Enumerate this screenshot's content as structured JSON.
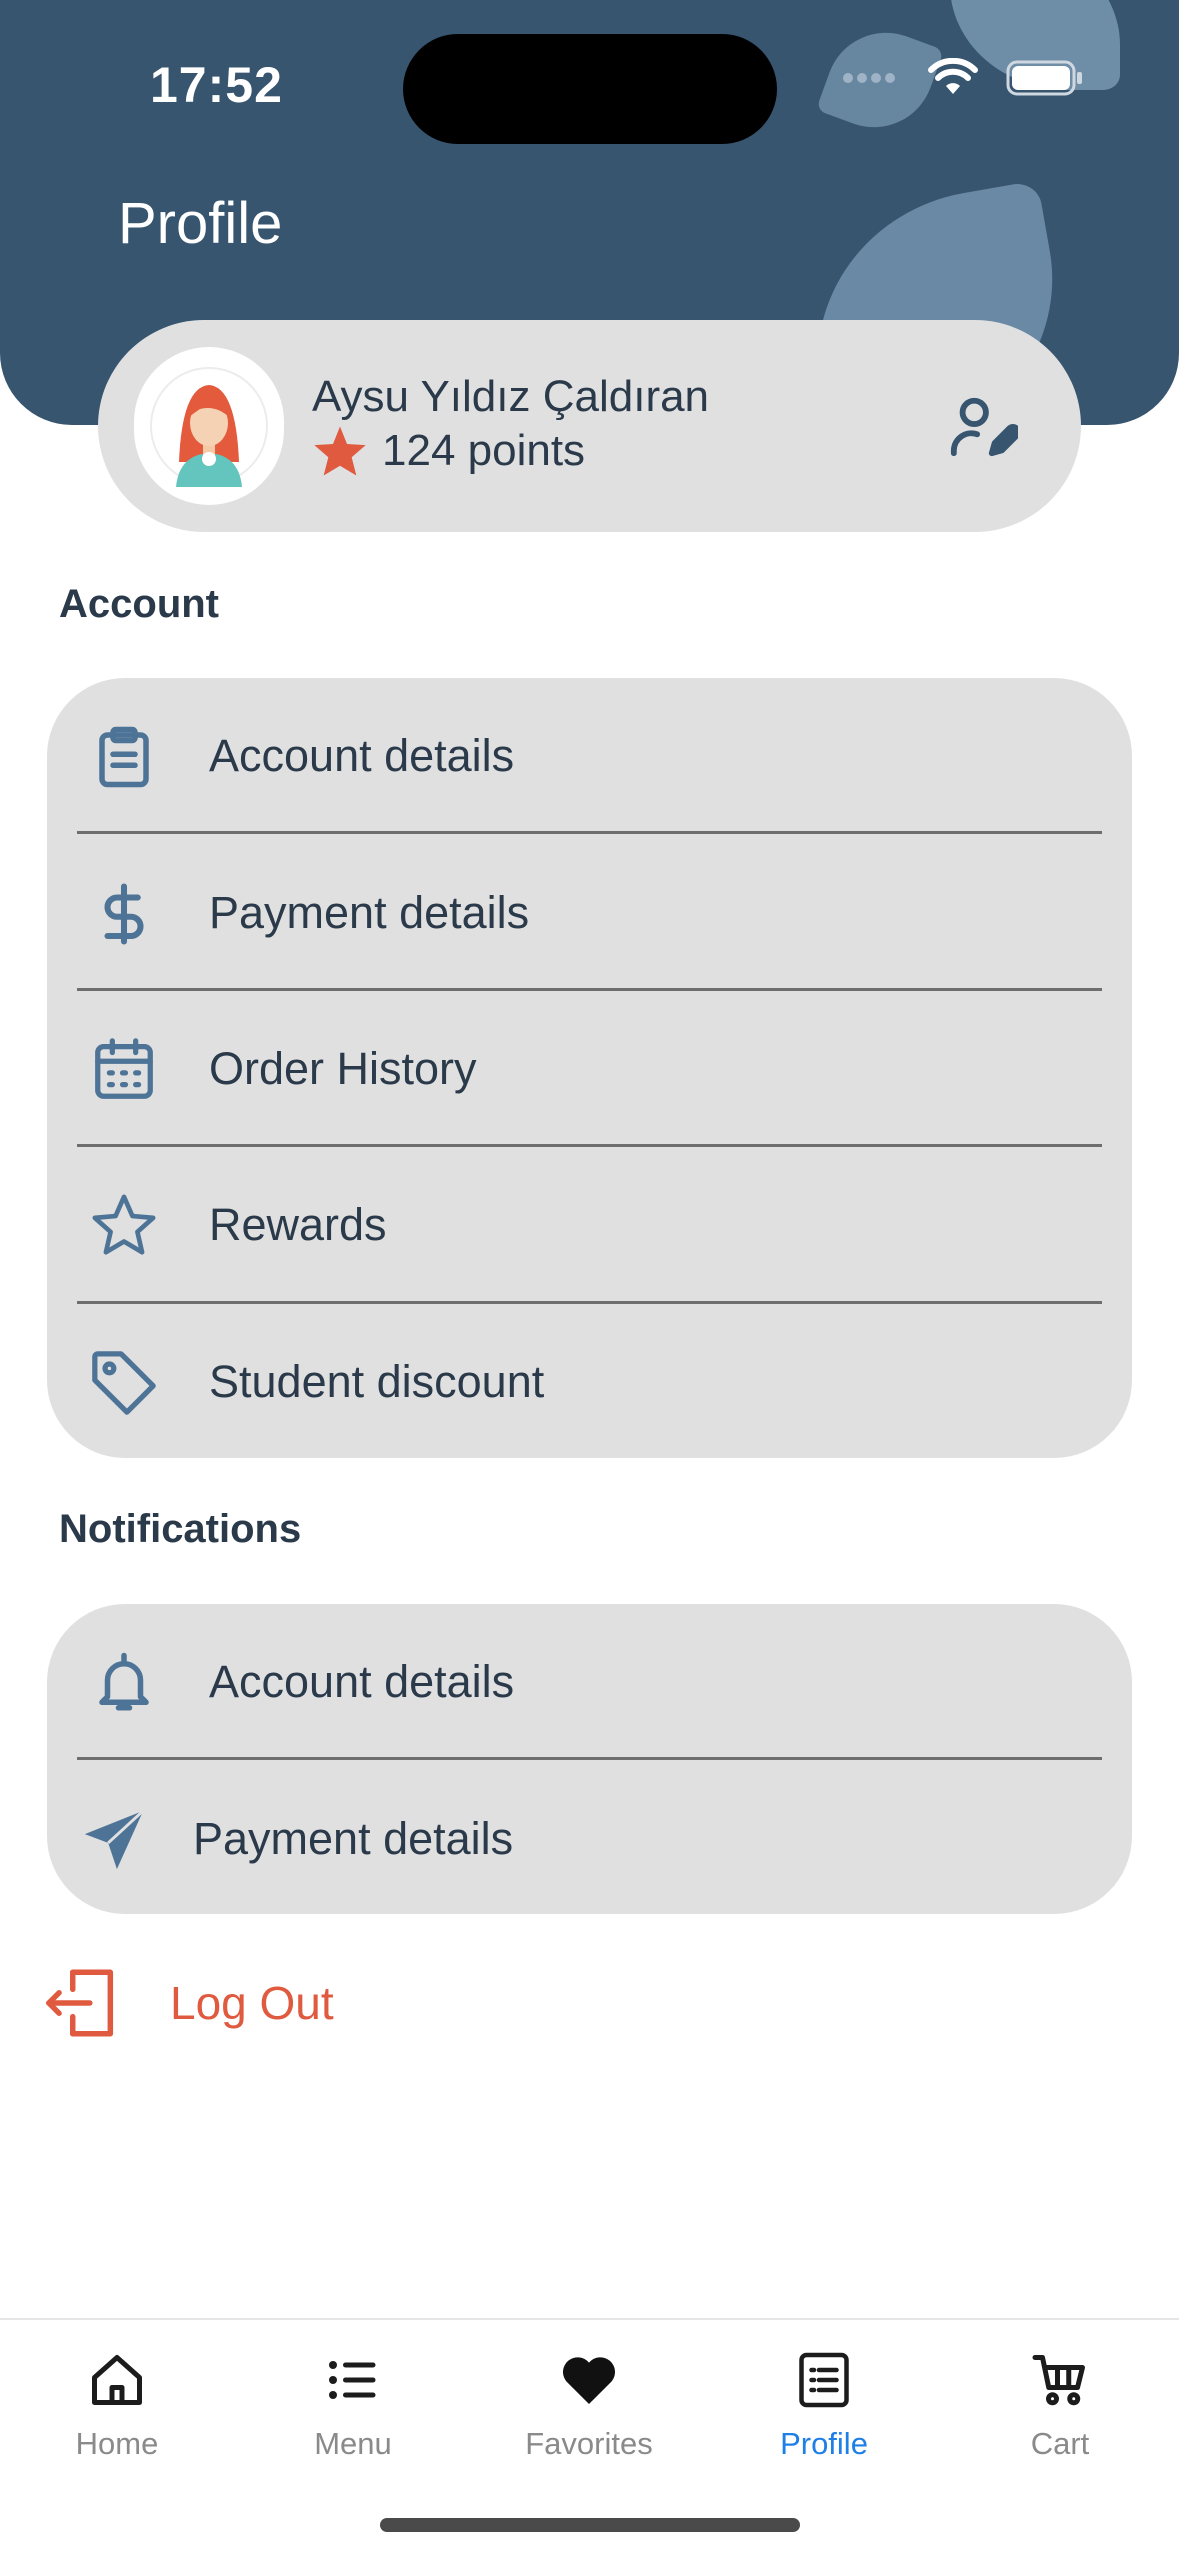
{
  "status_bar": {
    "time": "17:52"
  },
  "page": {
    "title": "Profile"
  },
  "profile": {
    "name": "Aysu Yıldız Çaldıran",
    "points": "124 points"
  },
  "account_section": {
    "title": "Account",
    "items": [
      {
        "label": "Account details",
        "icon": "clipboard-icon"
      },
      {
        "label": "Payment details",
        "icon": "dollar-icon"
      },
      {
        "label": "Order History",
        "icon": "calendar-icon"
      },
      {
        "label": "Rewards",
        "icon": "star-outline-icon"
      },
      {
        "label": "Student discount",
        "icon": "tag-icon"
      }
    ]
  },
  "notifications_section": {
    "title": "Notifications",
    "items": [
      {
        "label": "Account details",
        "icon": "bell-icon"
      },
      {
        "label": "Payment details",
        "icon": "navigation-arrow-icon"
      }
    ]
  },
  "logout": {
    "label": "Log Out"
  },
  "tabbar": {
    "items": [
      {
        "label": "Home",
        "icon": "home-icon"
      },
      {
        "label": "Menu",
        "icon": "list-icon"
      },
      {
        "label": "Favorites",
        "icon": "heart-icon"
      },
      {
        "label": "Profile",
        "icon": "document-list-icon",
        "active": true
      },
      {
        "label": "Cart",
        "icon": "cart-icon"
      }
    ]
  },
  "colors": {
    "header": "#37556f",
    "card": "#e0e0e0",
    "icon": "#4d7396",
    "accent_star": "#e05a3f",
    "logout": "#e05a3f",
    "active_tab": "#1e7fe6"
  }
}
